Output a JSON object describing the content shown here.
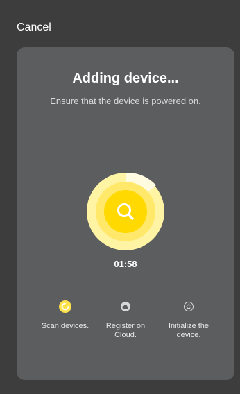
{
  "header": {
    "cancel_label": "Cancel"
  },
  "card": {
    "title": "Adding device...",
    "subtitle": "Ensure that the device is powered on.",
    "timer": "01:58"
  },
  "steps": [
    {
      "label": "Scan devices.",
      "state": "active",
      "icon": "loading-icon"
    },
    {
      "label": "Register on Cloud.",
      "state": "pending",
      "icon": "cloud-icon"
    },
    {
      "label": "Initialize the device.",
      "state": "pending",
      "icon": "initialize-icon"
    }
  ],
  "colors": {
    "background": "#3d3d3d",
    "card": "#5c5d5f",
    "accent": "#ffe24a"
  },
  "icons": {
    "search": "search-icon"
  }
}
